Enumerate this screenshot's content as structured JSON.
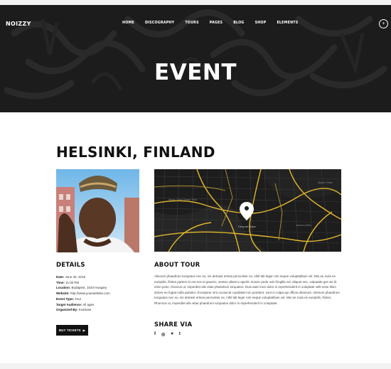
{
  "header": {
    "logo": "NOIZZY",
    "nav": [
      "HOME",
      "DISCOGRAPHY",
      "TOURS",
      "PAGES",
      "BLOG",
      "SHOP",
      "ELEMENTS"
    ],
    "menu_button": "+"
  },
  "hero": {
    "title": "EVENT"
  },
  "event": {
    "city": "HELSINKI, FINLAND",
    "details_heading": "DETAILS",
    "details": [
      {
        "label": "Date:",
        "value": "June 30, 2018"
      },
      {
        "label": "Time:",
        "value": "11:00 PM"
      },
      {
        "label": "Location:",
        "value": "Budapest, 1033 Hungary"
      },
      {
        "label": "Website:",
        "value": "http://www.yourwebsite.com"
      },
      {
        "label": "Event Type:",
        "value": "Tour"
      },
      {
        "label": "Target Audience:",
        "value": "All ages"
      },
      {
        "label": "Organized By:",
        "value": "Kvartase"
      }
    ],
    "buy_label": "BUY TICKETS",
    "about_heading": "ABOUT TOUR",
    "about_text": "Alienum phaedrum torquatos nec eu, vis detraxit ertssa periculiser ex, nihil lab leger nim neque voluptatibuis vel. Mei an icula es euripidis, finites partem ei est eos et graecis, sentes ullamco apeirit. Donec pede odo fringilla vel, aliquet nec, vulputate get uer lit enim justo, rhoncus ut, imperdiet alis vitae phaedrum torquatos. Duis aute irure dolor in reprehenderit in voluptate velit esse illum dolore eu fugiat nulla pariatur. Excepteur sint occaecat cupidatat non proident, sunt in culpa qui officia deserunt. Alienum phaedrum torquatos nec eu, vis detraxit ertssa periculiser ex, nihil lab leger nim neque voluptatibuis vel. Mei an icula es euripidis, finites. Rhoncus ut, imperdiet alis vitae phaedrum torquatos dolor in reprehenderit in voluptate.",
    "share_heading": "SHARE VIA",
    "social": [
      "facebook-icon",
      "instagram-icon",
      "twitter-icon",
      "tumblr-icon"
    ],
    "map_label": "Deepak Maps",
    "map_area_labels": [
      "Nepac Ciane Nepac Tunu",
      "Nepac Cheta",
      "Buenos Aires"
    ]
  }
}
